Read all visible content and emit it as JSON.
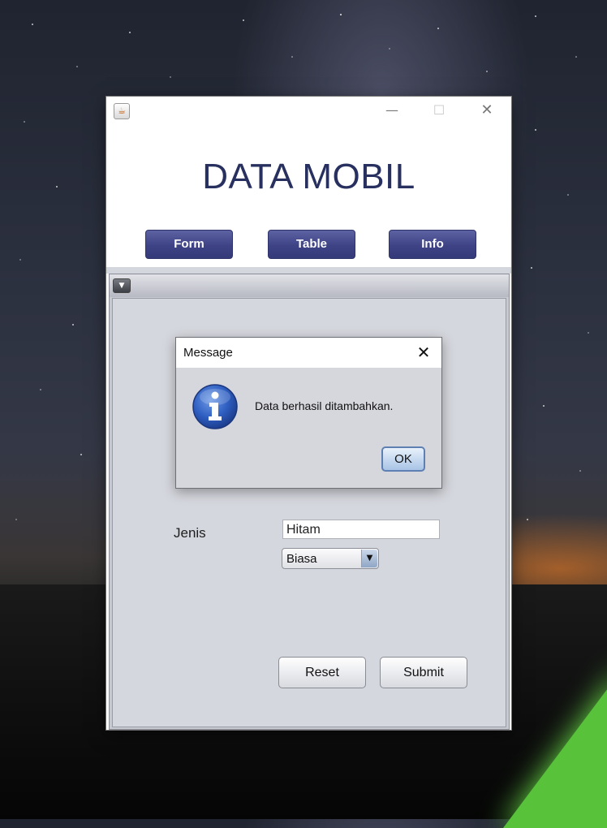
{
  "app": {
    "title": "DATA MOBIL",
    "nav": {
      "form": "Form",
      "table": "Table",
      "info": "Info"
    }
  },
  "form": {
    "warna_value": "Hitam",
    "jenis_label": "Jenis",
    "jenis_selected": "Biasa",
    "reset_label": "Reset",
    "submit_label": "Submit"
  },
  "dialog": {
    "title": "Message",
    "message": "Data berhasil ditambahkan.",
    "ok_label": "OK",
    "icon": "info-icon"
  },
  "colors": {
    "nav_button": "#3e4386",
    "title_text": "#27305f",
    "panel_bg": "#d5d7de"
  }
}
